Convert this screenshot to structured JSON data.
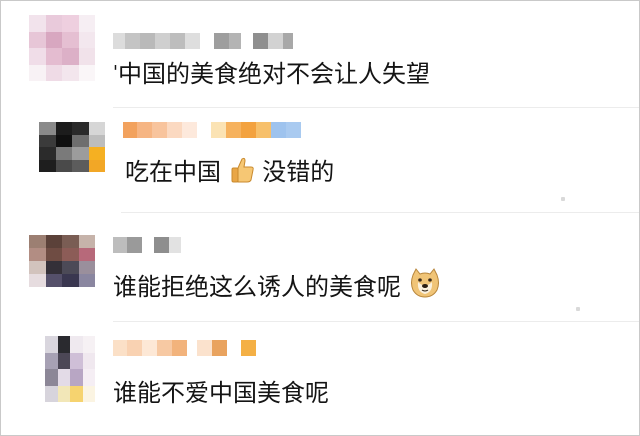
{
  "comments": [
    {
      "text": "中国的美食绝对不会让人失望",
      "prefix": "'"
    },
    {
      "text_before": "吃在中国",
      "emoji": "thumbs-up",
      "text_after": "没错的"
    },
    {
      "text": "谁能拒绝这么诱人的美食呢",
      "emoji": "doge"
    },
    {
      "text": "谁能不爱中国美食呢"
    }
  ],
  "colors": {
    "text": "#141414",
    "divider": "#ececec",
    "border": "#c9c9c9",
    "blur_gray": "#9a9a9a",
    "blur_orange": "#f4a43a",
    "blur_blue": "#9ec3ee"
  }
}
